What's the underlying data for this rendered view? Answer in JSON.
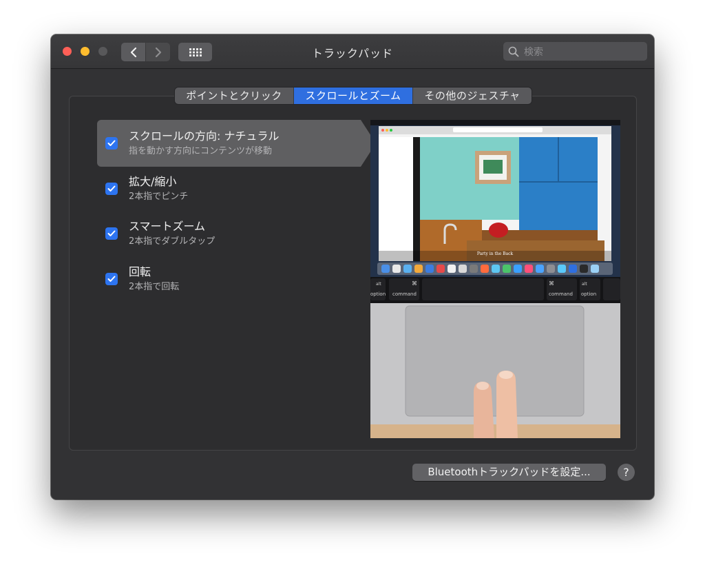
{
  "window": {
    "title": "トラックパッド",
    "search_placeholder": "検索"
  },
  "tabs": [
    {
      "label": "ポイントとクリック",
      "selected": false
    },
    {
      "label": "スクロールとズーム",
      "selected": true
    },
    {
      "label": "その他のジェスチャ",
      "selected": false
    }
  ],
  "options": [
    {
      "title": "スクロールの方向: ナチュラル",
      "subtitle": "指を動かす方向にコンテンツが移動",
      "checked": true,
      "selected": true
    },
    {
      "title": "拡大/縮小",
      "subtitle": "2本指でピンチ",
      "checked": true,
      "selected": false
    },
    {
      "title": "スマートズーム",
      "subtitle": "2本指でダブルタップ",
      "checked": true,
      "selected": false
    },
    {
      "title": "回転",
      "subtitle": "2本指で回転",
      "checked": true,
      "selected": false
    }
  ],
  "preview": {
    "caption": "Party in the Back",
    "keys": {
      "alt": "alt",
      "option": "option",
      "command": "command",
      "cmd_symbol": "⌘"
    }
  },
  "footer": {
    "bluetooth_button": "Bluetoothトラックパッドを設定...",
    "help_label": "?"
  },
  "colors": {
    "accent": "#2f6fe0",
    "window_bg": "#323234"
  }
}
